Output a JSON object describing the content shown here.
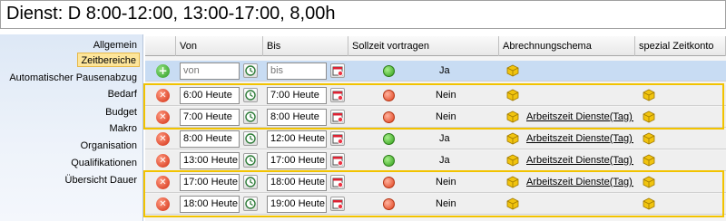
{
  "title": "Dienst: D 8:00-12:00, 13:00-17:00, 8,00h",
  "sidebar": {
    "items": [
      {
        "label": "Allgemein",
        "active": false
      },
      {
        "label": "Zeitbereiche",
        "active": true
      },
      {
        "label": "Automatischer Pausenabzug",
        "active": false
      },
      {
        "label": "Bedarf",
        "active": false
      },
      {
        "label": "Budget",
        "active": false
      },
      {
        "label": "Makro",
        "active": false
      },
      {
        "label": "Organisation",
        "active": false
      },
      {
        "label": "Qualifikationen",
        "active": false
      },
      {
        "label": "Übersicht Dauer",
        "active": false
      }
    ]
  },
  "table": {
    "headers": {
      "von": "Von",
      "bis": "Bis",
      "sollzeit": "Sollzeit vortragen",
      "abrechnung": "Abrechnungschema",
      "spezial": "spezial Zeitkonto"
    },
    "new_row": {
      "von_placeholder": "von",
      "bis_placeholder": "bis",
      "sollzeit": "Ja",
      "status": "green"
    },
    "rows": [
      {
        "von": "6:00 Heute",
        "bis": "7:00 Heute",
        "sollzeit": "Nein",
        "status": "red",
        "schema": ""
      },
      {
        "von": "7:00 Heute",
        "bis": "8:00 Heute",
        "sollzeit": "Nein",
        "status": "red",
        "schema": "Arbeitszeit Dienste(Tag)_S"
      },
      {
        "von": "8:00 Heute",
        "bis": "12:00 Heute",
        "sollzeit": "Ja",
        "status": "green",
        "schema": "Arbeitszeit Dienste(Tag)_S"
      },
      {
        "von": "13:00 Heute",
        "bis": "17:00 Heute",
        "sollzeit": "Ja",
        "status": "green",
        "schema": "Arbeitszeit Dienste(Tag)_S"
      },
      {
        "von": "17:00 Heute",
        "bis": "18:00 Heute",
        "sollzeit": "Nein",
        "status": "red",
        "schema": "Arbeitszeit Dienste(Tag)_S"
      },
      {
        "von": "18:00 Heute",
        "bis": "19:00 Heute",
        "sollzeit": "Nein",
        "status": "red",
        "schema": ""
      }
    ]
  },
  "colors": {
    "highlight": "#f2c300",
    "new_row_bg": "#c8dcf3",
    "active_tab": "#fde59a"
  },
  "icons": {
    "add": "plus-circle-icon",
    "delete": "x-circle-icon",
    "time_picker": "clock-icon",
    "date_picker": "calendar-icon",
    "schema": "cube-icon"
  }
}
